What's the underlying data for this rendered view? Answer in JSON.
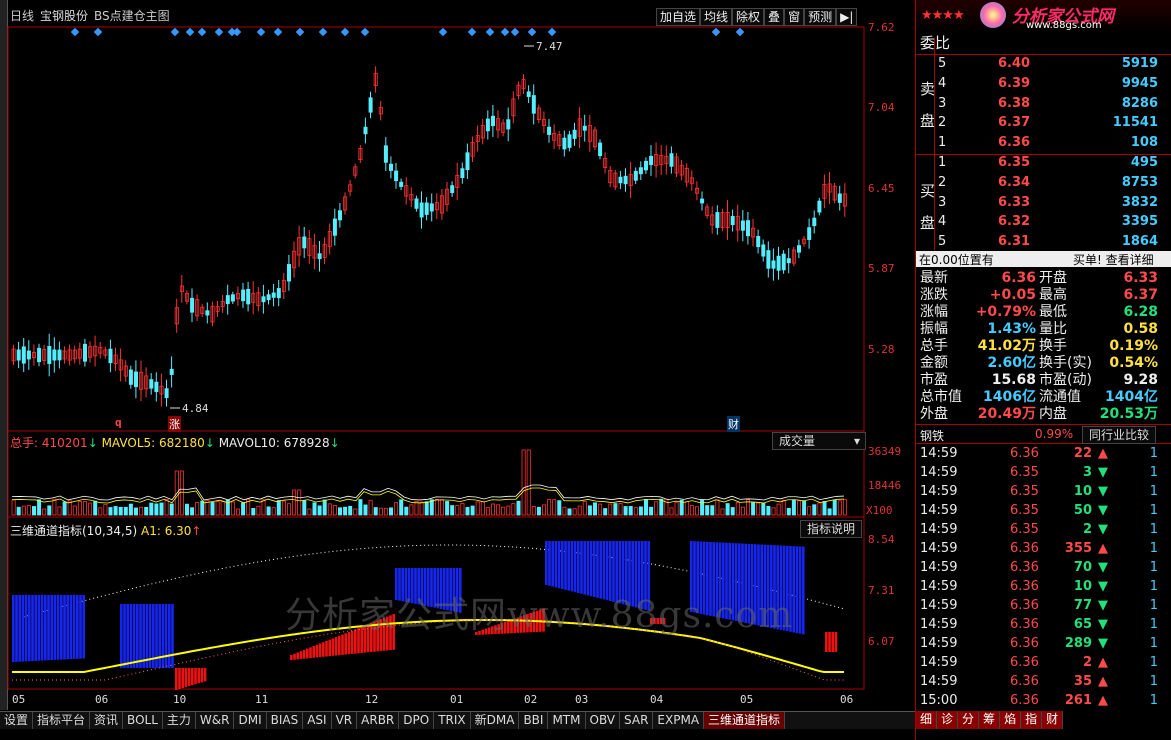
{
  "header": {
    "period": "日线",
    "stock_name": "宝钢股份",
    "formula": "BS点建仓主图",
    "buttons": [
      "加自选",
      "均线",
      "除权",
      "叠",
      "窗",
      "预测",
      "▶|"
    ]
  },
  "price_axis": [
    "7.62",
    "7.04",
    "6.45",
    "5.87",
    "5.28"
  ],
  "price_annotations": {
    "high": "7.47",
    "low": "4.84"
  },
  "markers": {
    "q": "q",
    "zhang": "涨",
    "cai": "财"
  },
  "volume_panel": {
    "title": "总手",
    "total": "410201",
    "ma5_label": "MAVOL5",
    "ma5": "682180",
    "ma10_label": "MAVOL10",
    "ma10": "678928",
    "dropdown": "成交量",
    "axis": [
      "36349",
      "18446",
      "X100"
    ]
  },
  "indicator_panel": {
    "title": "三维通道指标(10,34,5)",
    "a1_label": "A1",
    "a1": "6.30",
    "button": "指标说明",
    "axis": [
      "8.54",
      "7.31",
      "6.07"
    ]
  },
  "date_axis": [
    "05",
    "06",
    "10",
    "11",
    "12",
    "01",
    "02",
    "03",
    "04",
    "05",
    "06"
  ],
  "watermark": "分析家公式网www.88gs.com",
  "logo": {
    "name": "分析家公式网",
    "url": "www.88gs.com"
  },
  "quote": {
    "weibi_label": "委比",
    "sell_label": [
      "卖",
      "盘"
    ],
    "buy_label": [
      "买",
      "盘"
    ],
    "sell": [
      {
        "lvl": "5",
        "price": "6.40",
        "vol": "5919"
      },
      {
        "lvl": "4",
        "price": "6.39",
        "vol": "9945"
      },
      {
        "lvl": "3",
        "price": "6.38",
        "vol": "8286"
      },
      {
        "lvl": "2",
        "price": "6.37",
        "vol": "11541"
      },
      {
        "lvl": "1",
        "price": "6.36",
        "vol": "108"
      }
    ],
    "buy": [
      {
        "lvl": "1",
        "price": "6.35",
        "vol": "495"
      },
      {
        "lvl": "2",
        "price": "6.34",
        "vol": "8753"
      },
      {
        "lvl": "3",
        "price": "6.33",
        "vol": "3832"
      },
      {
        "lvl": "4",
        "price": "6.32",
        "vol": "3395"
      },
      {
        "lvl": "5",
        "price": "6.31",
        "vol": "1864"
      }
    ],
    "position_note": "在0.00位置有",
    "detail_link": "买单! 查看详细",
    "stats": [
      {
        "l1": "最新",
        "v1": "6.36",
        "c1": "red",
        "l2": "开盘",
        "v2": "6.33",
        "c2": "red"
      },
      {
        "l1": "涨跌",
        "v1": "+0.05",
        "c1": "red",
        "l2": "最高",
        "v2": "6.37",
        "c2": "red"
      },
      {
        "l1": "涨幅",
        "v1": "+0.79%",
        "c1": "red",
        "l2": "最低",
        "v2": "6.28",
        "c2": "green"
      },
      {
        "l1": "振幅",
        "v1": "1.43%",
        "c1": "cyan",
        "l2": "量比",
        "v2": "0.58",
        "c2": "yellow"
      },
      {
        "l1": "总手",
        "v1": "41.02万",
        "c1": "yellow",
        "l2": "换手",
        "v2": "0.19%",
        "c2": "yellow"
      },
      {
        "l1": "金额",
        "v1": "2.60亿",
        "c1": "cyan",
        "l2": "换手(实)",
        "v2": "0.54%",
        "c2": "yellow"
      },
      {
        "l1": "市盈",
        "v1": "15.68",
        "c1": "white",
        "l2": "市盈(动)",
        "v2": "9.28",
        "c2": "white"
      },
      {
        "l1": "总市值",
        "v1": "1406亿",
        "c1": "cyan",
        "l2": "流通值",
        "v2": "1404亿",
        "c2": "cyan"
      },
      {
        "l1": "外盘",
        "v1": "20.49万",
        "c1": "red",
        "l2": "内盘",
        "v2": "20.53万",
        "c2": "green"
      }
    ],
    "industry": {
      "name": "钢铁",
      "pct": "0.99%",
      "link": "同行业比较"
    },
    "ticks": [
      {
        "t": "14:59",
        "p": "6.36",
        "v": "22",
        "dir": "up",
        "n": "1"
      },
      {
        "t": "14:59",
        "p": "6.35",
        "v": "3",
        "dir": "down",
        "n": "1"
      },
      {
        "t": "14:59",
        "p": "6.35",
        "v": "10",
        "dir": "down",
        "n": "1"
      },
      {
        "t": "14:59",
        "p": "6.35",
        "v": "50",
        "dir": "down",
        "n": "1"
      },
      {
        "t": "14:59",
        "p": "6.35",
        "v": "2",
        "dir": "down",
        "n": "1"
      },
      {
        "t": "14:59",
        "p": "6.36",
        "v": "355",
        "dir": "up",
        "n": "1"
      },
      {
        "t": "14:59",
        "p": "6.36",
        "v": "70",
        "dir": "down",
        "n": "1"
      },
      {
        "t": "14:59",
        "p": "6.36",
        "v": "10",
        "dir": "down",
        "n": "1"
      },
      {
        "t": "14:59",
        "p": "6.36",
        "v": "77",
        "dir": "down",
        "n": "1"
      },
      {
        "t": "14:59",
        "p": "6.36",
        "v": "65",
        "dir": "down",
        "n": "1"
      },
      {
        "t": "14:59",
        "p": "6.36",
        "v": "289",
        "dir": "down",
        "n": "1"
      },
      {
        "t": "14:59",
        "p": "6.36",
        "v": "2",
        "dir": "up",
        "n": "1"
      },
      {
        "t": "14:59",
        "p": "6.36",
        "v": "35",
        "dir": "up",
        "n": "1"
      },
      {
        "t": "15:00",
        "p": "6.36",
        "v": "261",
        "dir": "up",
        "n": "1"
      }
    ]
  },
  "bottom_tabs": [
    "设置",
    "指标平台",
    "资讯",
    "BOLL",
    "主力",
    "W&R",
    "DMI",
    "BIAS",
    "ASI",
    "VR",
    "ARBR",
    "DPO",
    "TRIX",
    "新DMA",
    "BBI",
    "MTM",
    "OBV",
    "SAR",
    "EXPMA",
    "三维通道指标"
  ],
  "right_tabs": [
    "细",
    "诊",
    "分",
    "筹",
    "焰",
    "指",
    "财"
  ]
}
